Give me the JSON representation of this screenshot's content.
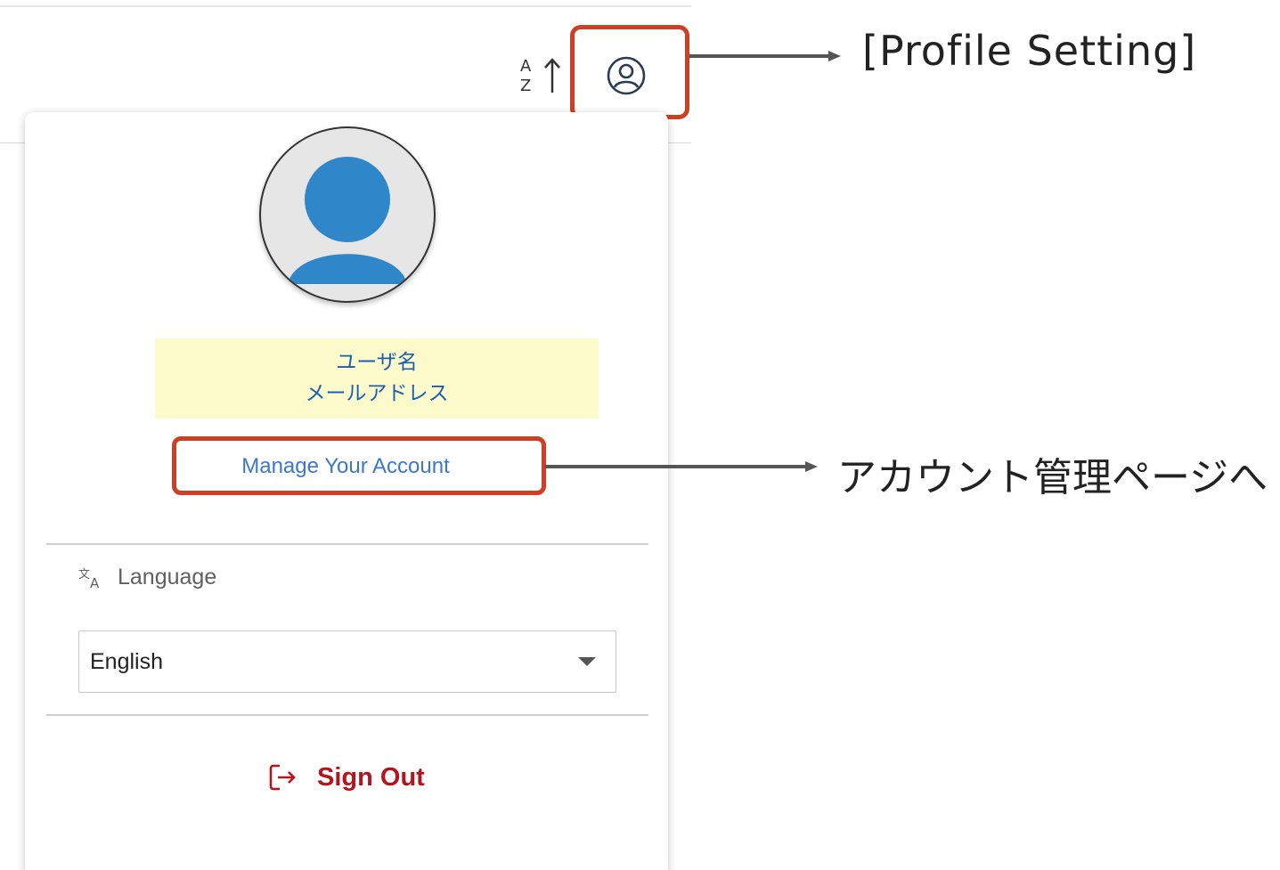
{
  "annotations": {
    "profile_setting": "[Profile Setting]",
    "manage_account_target": "アカウント管理ページへ"
  },
  "toolbar": {
    "sort_icon": "sort-az-ascending-icon",
    "profile_icon": "user-circle-icon"
  },
  "profile_menu": {
    "user_name": "ユーザ名",
    "user_email": "メールアドレス",
    "manage_account": "Manage Your Account",
    "language_label": "Language",
    "language_icon": "translate-icon",
    "language_selected": "English",
    "sign_out": "Sign Out",
    "sign_out_icon": "logout-icon"
  },
  "colors": {
    "highlight": "#cc4125",
    "link": "#3c78c8",
    "sign_out": "#b3141e",
    "avatar": "#2f86c8",
    "user_box_bg": "#fdfbcb",
    "user_text": "#1a5fb4"
  }
}
